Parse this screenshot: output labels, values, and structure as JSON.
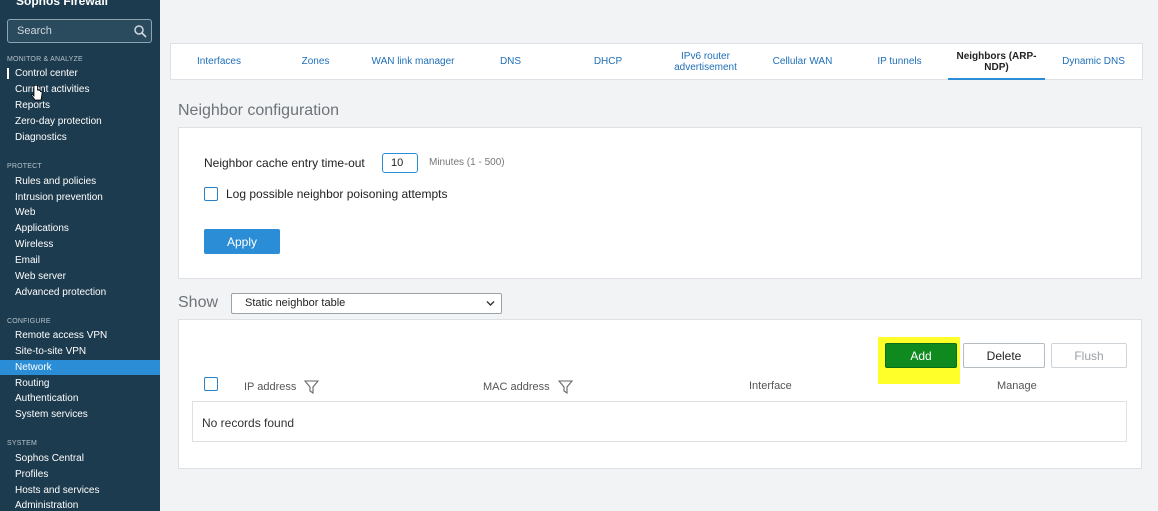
{
  "sidebar": {
    "brand": "Sophos Firewall",
    "search_placeholder": "Search",
    "sections": {
      "monitor": "MONITOR & ANALYZE",
      "protect": "PROTECT",
      "configure": "CONFIGURE",
      "system": "SYSTEM"
    },
    "monitor_items": [
      "Control center",
      "Current activities",
      "Reports",
      "Zero-day protection",
      "Diagnostics"
    ],
    "protect_items": [
      "Rules and policies",
      "Intrusion prevention",
      "Web",
      "Applications",
      "Wireless",
      "Email",
      "Web server",
      "Advanced protection"
    ],
    "configure_items": [
      "Remote access VPN",
      "Site-to-site VPN",
      "Network",
      "Routing",
      "Authentication",
      "System services"
    ],
    "system_items": [
      "Sophos Central",
      "Profiles",
      "Hosts and services",
      "Administration"
    ]
  },
  "tabs": [
    "Interfaces",
    "Zones",
    "WAN link manager",
    "DNS",
    "DHCP",
    "IPv6 router advertisement",
    "Cellular WAN",
    "IP tunnels",
    "Neighbors (ARP-NDP)",
    "Dynamic DNS"
  ],
  "active_tab": "Neighbors (ARP-NDP)",
  "neighbor_config": {
    "heading": "Neighbor configuration",
    "timeout_label": "Neighbor cache entry time-out",
    "timeout_value": "10",
    "timeout_hint": "Minutes (1 - 500)",
    "log_label": "Log possible neighbor poisoning attempts",
    "apply_label": "Apply"
  },
  "show": {
    "label": "Show",
    "selected": "Static neighbor table"
  },
  "table": {
    "add_label": "Add",
    "delete_label": "Delete",
    "flush_label": "Flush",
    "columns": [
      "IP address",
      "MAC address",
      "Interface",
      "Manage"
    ],
    "empty_text": "No records found"
  },
  "colors": {
    "sidebar_bg": "#1d3b4e",
    "accent": "#2b8dd6",
    "add_green": "#0f8a1e",
    "highlight": "#ffff2a"
  }
}
